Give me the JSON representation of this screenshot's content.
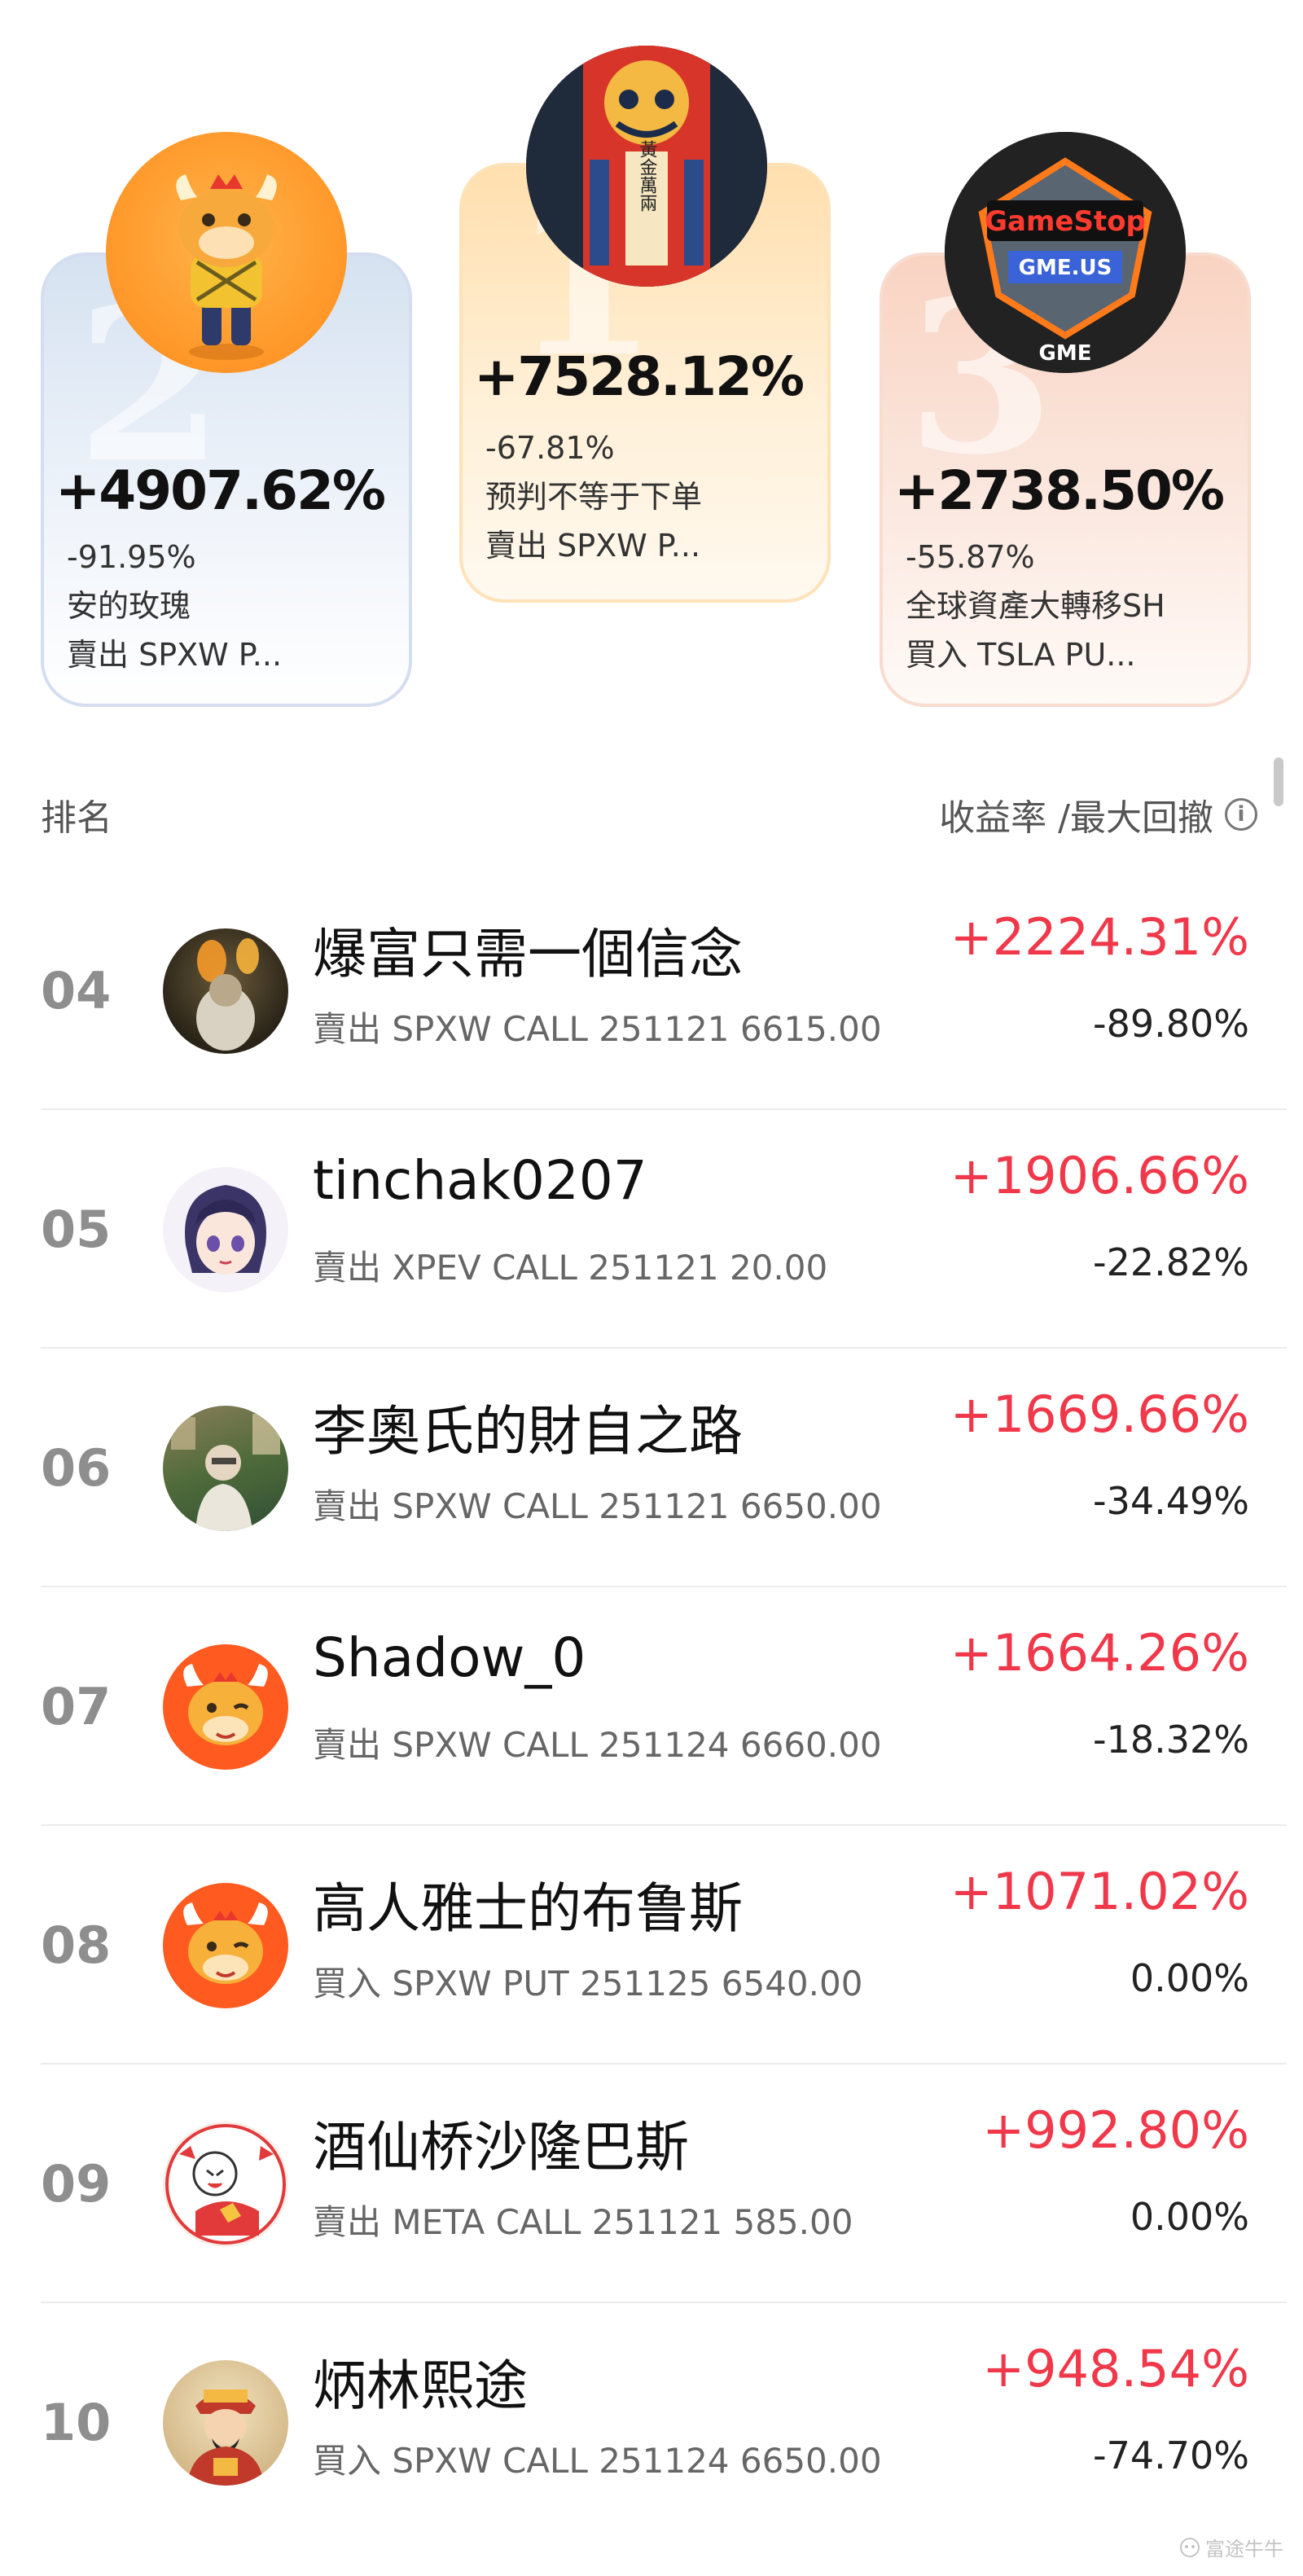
{
  "podium": [
    {
      "rank": "1",
      "gain": "+7528.12%",
      "drawdown": "-67.81%",
      "name": "预判不等于下单",
      "trade": "賣出 SPXW P..."
    },
    {
      "rank": "2",
      "gain": "+4907.62%",
      "drawdown": "-91.95%",
      "name": "安的玫瑰",
      "trade": "賣出 SPXW P..."
    },
    {
      "rank": "3",
      "gain": "+2738.50%",
      "drawdown": "-55.87%",
      "name": "全球資產大轉移SH",
      "trade": "買入 TSLA PU..."
    }
  ],
  "gme_badge": {
    "line1": "GameStop",
    "line2": "GME.US",
    "line3": "GME"
  },
  "talisman_text": "黃金萬兩",
  "list_header": {
    "rank_label": "排名",
    "metric_label": "收益率 /最大回撤",
    "info_icon": "i"
  },
  "rows": [
    {
      "rank": "04",
      "name": "爆富只需一個信念",
      "trade": "賣出 SPXW CALL 251121 6615.00",
      "gain": "+2224.31%",
      "drawdown": "-89.80%",
      "avatar": "photo-fire"
    },
    {
      "rank": "05",
      "name": "tinchak0207",
      "trade": "賣出 XPEV CALL 251121 20.00",
      "gain": "+1906.66%",
      "drawdown": "-22.82%",
      "avatar": "anime-girl"
    },
    {
      "rank": "06",
      "name": "李奧氏的財自之路",
      "trade": "賣出 SPXW CALL 251121 6650.00",
      "gain": "+1669.66%",
      "drawdown": "-34.49%",
      "avatar": "photo-street"
    },
    {
      "rank": "07",
      "name": "Shadow_0",
      "trade": "賣出 SPXW CALL 251124 6660.00",
      "gain": "+1664.26%",
      "drawdown": "-18.32%",
      "avatar": "bull-mascot"
    },
    {
      "rank": "08",
      "name": "高人雅士的布鲁斯",
      "trade": "買入 SPXW PUT 251125 6540.00",
      "gain": "+1071.02%",
      "drawdown": "0.00%",
      "avatar": "bull-mascot"
    },
    {
      "rank": "09",
      "name": "酒仙桥沙隆巴斯",
      "trade": "賣出 META CALL 251121 585.00",
      "gain": "+992.80%",
      "drawdown": "0.00%",
      "avatar": "cartoon-red"
    },
    {
      "rank": "10",
      "name": "炳林熙途",
      "trade": "買入 SPXW CALL 251124 6650.00",
      "gain": "+948.54%",
      "drawdown": "-74.70%",
      "avatar": "fortune-god"
    }
  ],
  "watermark": "富途牛牛",
  "colors": {
    "gain_red": "#f0384a",
    "rank_gray": "#8e8e8e",
    "bull_orange": "#ff5a1f"
  }
}
